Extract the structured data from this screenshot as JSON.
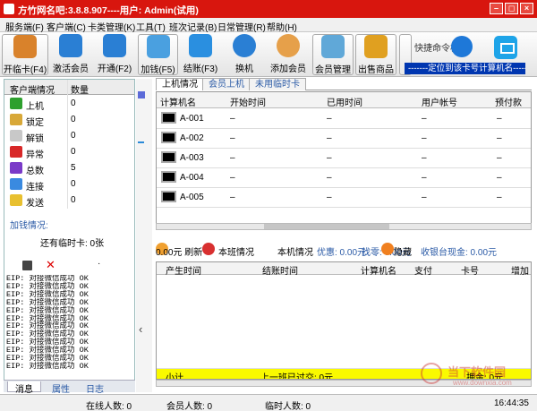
{
  "window": {
    "title": "方竹网名吧:3.8.8.907----用户: Admin(试用)",
    "controls": [
      "–",
      "◻",
      "×"
    ]
  },
  "menu": [
    "服务端(F)",
    "客户端(C)",
    "卡类管理(K)",
    "工具(T)",
    "班次记录(B)",
    "日常管理(R)",
    "帮助(H)"
  ],
  "toolbar": [
    {
      "label": "开临卡(F4)",
      "icon": "pencil-icon",
      "color": "#d9822b"
    },
    {
      "label": "激活会员",
      "icon": "arrow-up-icon",
      "color": "#2a7fd4"
    },
    {
      "label": "开通(F2)",
      "icon": "stop-square-icon",
      "color": "#2a7fd4"
    },
    {
      "label": "加钱(F5)",
      "icon": "money-icon",
      "color": "#4aa0e0"
    },
    {
      "label": "结账(F3)",
      "icon": "chat-bubble-icon",
      "color": "#2a8fe0"
    },
    {
      "label": "换机",
      "icon": "refresh-icon",
      "color": "#2a7fd4"
    },
    {
      "label": "添加会员",
      "icon": "add-member-icon",
      "color": "#e6a04a"
    },
    {
      "label": "会员管理",
      "icon": "member-cards-icon",
      "color": "#60a8d8"
    },
    {
      "label": "出售商品",
      "icon": "sell-arrows-icon",
      "color": "#e0a020"
    },
    {
      "label": "上",
      "icon": "more-icon",
      "color": "#888888"
    }
  ],
  "command": {
    "label": "快捷命令栏",
    "placeholder": "-------定位到该卡号计算机名-------"
  },
  "left_panel": {
    "headers": [
      "客户端情况",
      "数量"
    ],
    "rows": [
      {
        "label": "上机",
        "count": "0",
        "icon": "check-icon",
        "color": "#2ea02e"
      },
      {
        "label": "锁定",
        "count": "0",
        "icon": "lock-icon",
        "color": "#d8a838"
      },
      {
        "label": "解锁",
        "count": "0",
        "icon": "unlock-icon",
        "color": "#c8c8c8"
      },
      {
        "label": "异常",
        "count": "0",
        "icon": "error-monitor-icon",
        "color": "#d82828"
      },
      {
        "label": "总数",
        "count": "5",
        "icon": "stack-icon",
        "color": "#7a3ac8"
      },
      {
        "label": "连接",
        "count": "0",
        "icon": "connect-monitor-icon",
        "color": "#3a8ae0"
      },
      {
        "label": "发送",
        "count": "0",
        "icon": "warning-icon",
        "color": "#e8c030"
      }
    ],
    "add_money_label": "加钱情况:",
    "temp_card_text": "还有临时卡: 0张",
    "dot": "·",
    "log_lines": [
      "EIP: 对接微信成功 OK",
      "EIP: 对接微信成功 OK",
      "EIP: 对接微信成功 OK",
      "EIP: 对接微信成功 OK",
      "EIP: 对接微信成功 OK",
      "EIP: 对接微信成功 OK",
      "EIP: 对接微信成功 OK",
      "EIP: 对接微信成功 OK",
      "EIP: 对接微信成功 OK",
      "EIP: 对接微信成功 OK",
      "EIP: 对接微信成功 OK",
      "EIP: 对接微信成功 OK"
    ],
    "tabs": [
      "消息",
      "属性",
      "日志"
    ]
  },
  "main_tabs": [
    "上机情况",
    "会员上机",
    "未用临时卡"
  ],
  "grid": {
    "columns": [
      "计算机名",
      "开始时间",
      "已用时间",
      "用户帐号",
      "预付款"
    ],
    "rows": [
      {
        "name": "A-001",
        "start": "–",
        "used": "–",
        "account": "–",
        "prepay": "–"
      },
      {
        "name": "A-002",
        "start": "–",
        "used": "–",
        "account": "–",
        "prepay": "–"
      },
      {
        "name": "A-003",
        "start": "–",
        "used": "–",
        "account": "–",
        "prepay": "–"
      },
      {
        "name": "A-004",
        "start": "–",
        "used": "–",
        "account": "–",
        "prepay": "–"
      },
      {
        "name": "A-005",
        "start": "–",
        "used": "–",
        "account": "–",
        "prepay": "–"
      }
    ]
  },
  "status": {
    "refresh": "0.00元 刷新",
    "local_status": "本班情况",
    "machine_status": "本机情况",
    "discount": "优惠: 0.00元",
    "change": "找零: 0.00元",
    "hide": "隐藏",
    "cash": "收银台现金: 0.00元"
  },
  "bottom_grid": {
    "columns": [
      "产生时间",
      "结账时间",
      "计算机名",
      "支付",
      "卡号",
      "增加"
    ],
    "total_label": "小计",
    "prev_shift": "上一班已过交: 0元",
    "deposit": "押金: 0元"
  },
  "bottom_bar": {
    "online": "在线人数: 0",
    "members": "会员人数: 0",
    "temp": "临时人数: 0",
    "time": "16:44:35"
  },
  "watermark": {
    "title": "当下软件园",
    "url": "www.downxia.com"
  }
}
